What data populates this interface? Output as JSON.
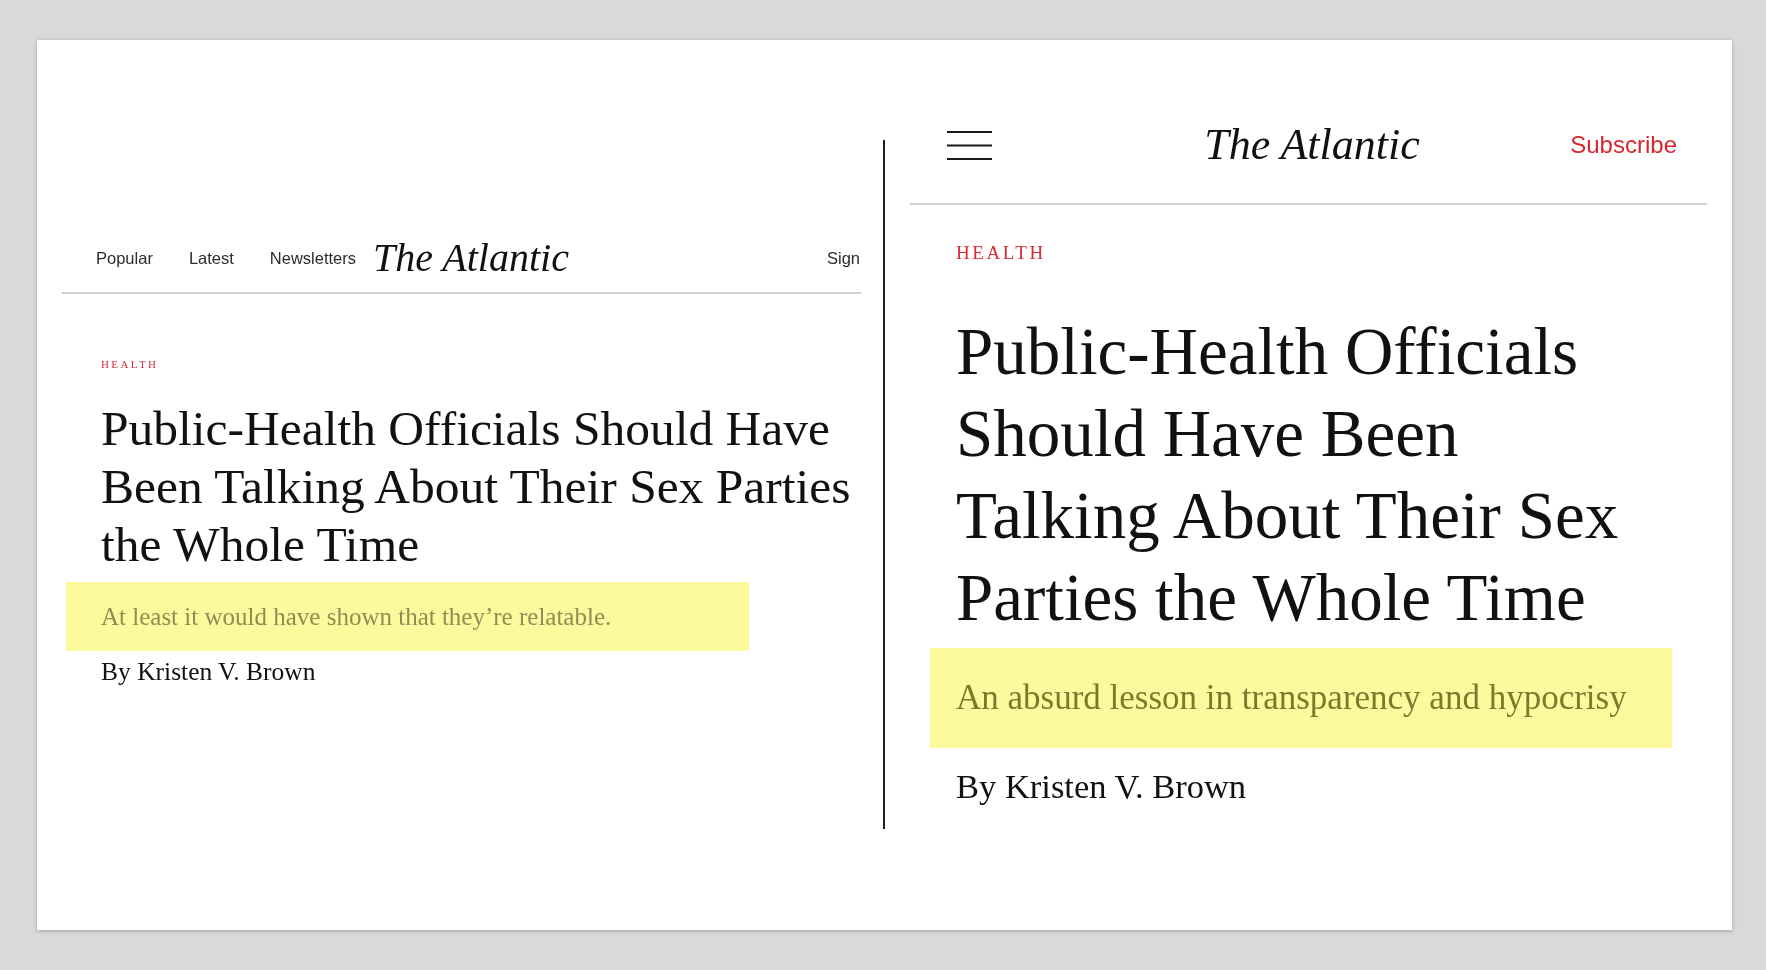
{
  "panels": [
    {
      "kind": "desktop",
      "nav": [
        "Popular",
        "Latest",
        "Newsletters"
      ],
      "logo": "The Atlantic",
      "account_link": "Sign",
      "section": "HEALTH",
      "headline": "Public-Health Officials Should Have Been Talking About Their Sex Parties the Whole Time",
      "dek": {
        "text": "At least it would have shown that they’re relatable.",
        "highlighted": true
      },
      "byline": "By Kristen V. Brown"
    },
    {
      "kind": "mobile",
      "logo": "The Atlantic",
      "subscribe_link": "Subscribe",
      "section": "HEALTH",
      "headline": "Public-Health Officials Should Have Been Talking About Their Sex Parties the Whole Time",
      "dek": {
        "text": "An absurd lesson in transparency and hypocrisy",
        "highlighted": true
      },
      "byline": "By Kristen V. Brown"
    }
  ]
}
